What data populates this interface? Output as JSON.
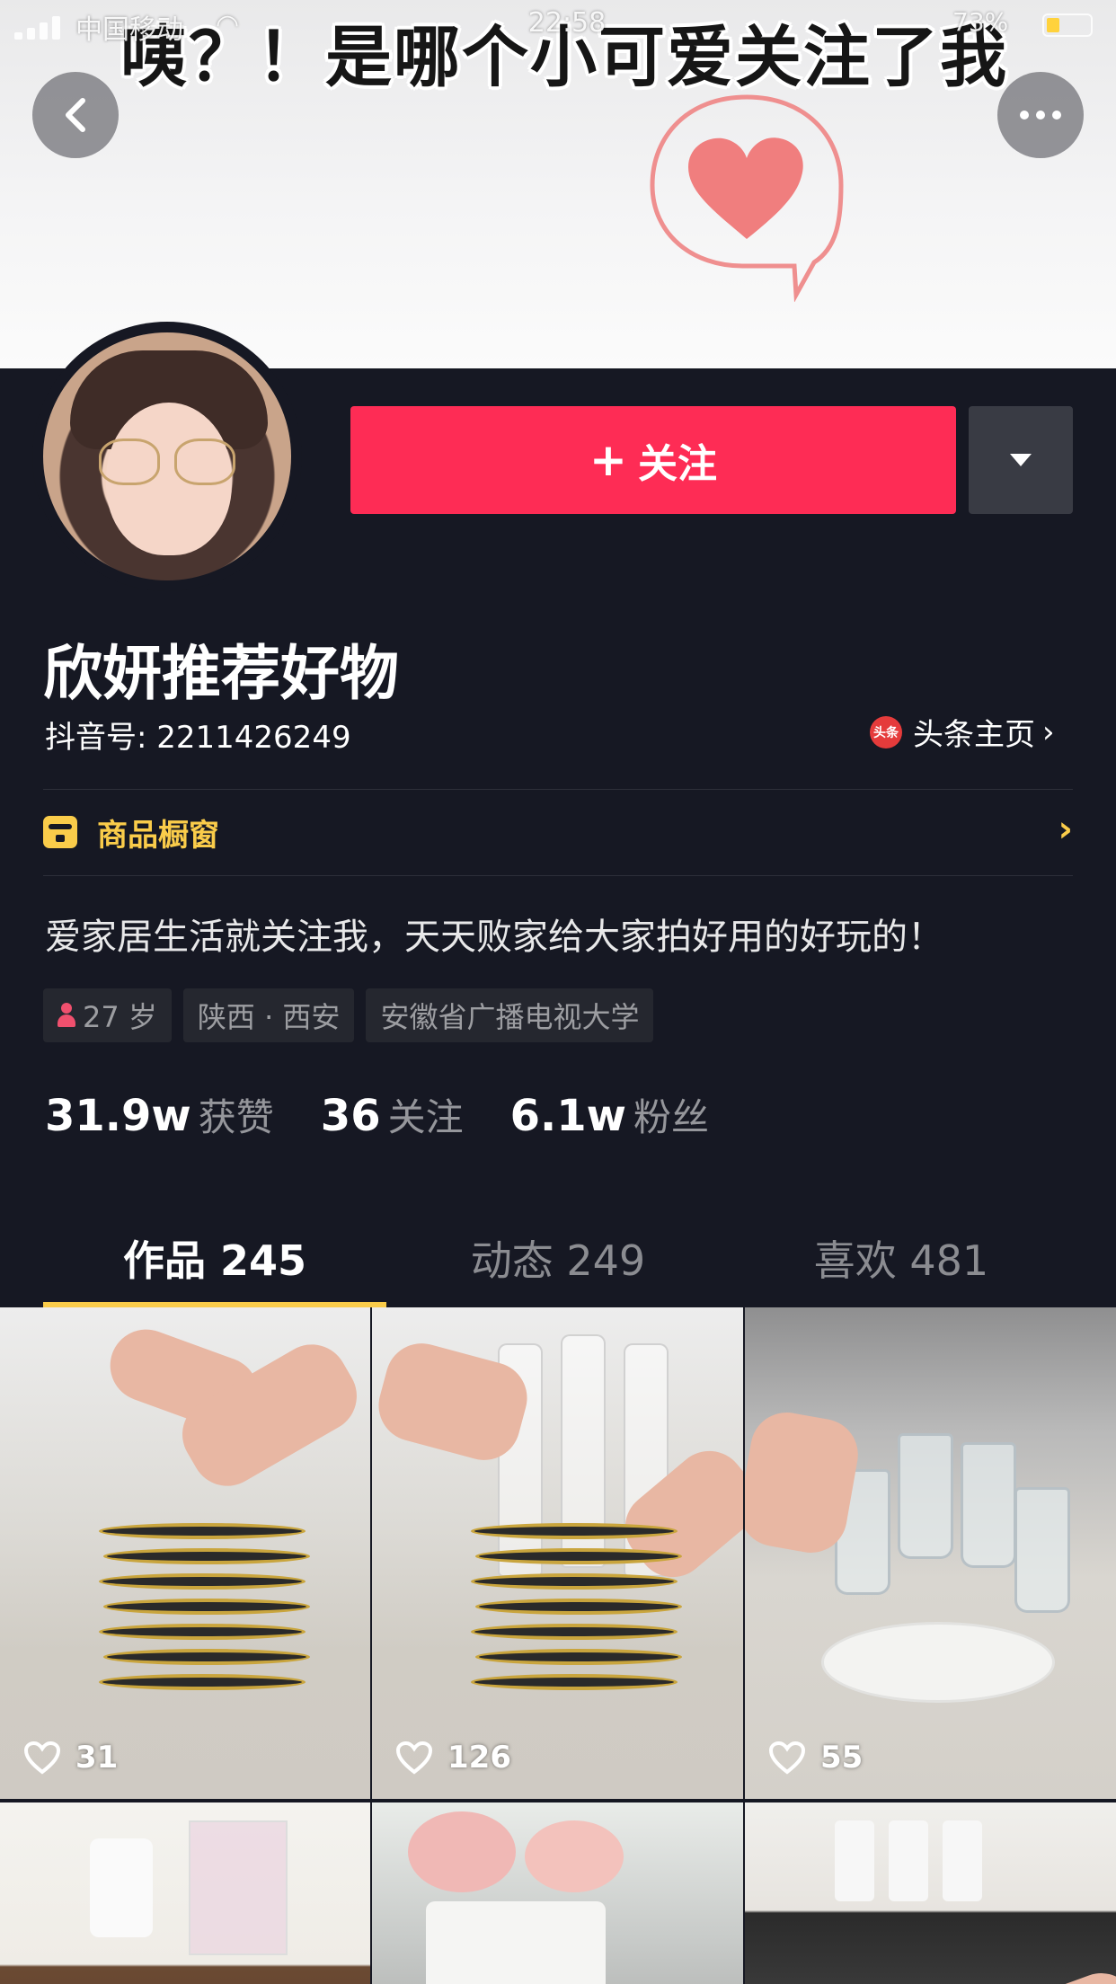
{
  "status_bar": {
    "carrier": "中国移动",
    "time": "22:58",
    "battery_pct": "73%"
  },
  "cover": {
    "caption": "咦？！是哪个小可爱关注了我"
  },
  "profile": {
    "follow_label": "关注",
    "nickname": "欣妍推荐好物",
    "douyin_id": "抖音号: 2211426249",
    "toutiao_badge": "头条",
    "toutiao_label": "头条主页",
    "shop_label": "商品橱窗",
    "bio": "爱家居生活就关注我，天天败家给大家拍好用的好玩的！",
    "tags": {
      "age": "27 岁",
      "location": "陕西 · 西安",
      "school": "安徽省广播电视大学"
    },
    "stats": [
      {
        "num": "31.9w",
        "label": "获赞"
      },
      {
        "num": "36",
        "label": "关注"
      },
      {
        "num": "6.1w",
        "label": "粉丝"
      }
    ]
  },
  "tabs": [
    {
      "label": "作品 245"
    },
    {
      "label": "动态 249"
    },
    {
      "label": "喜欢 481"
    }
  ],
  "videos": [
    {
      "likes": "31"
    },
    {
      "likes": "126"
    },
    {
      "likes": "55"
    }
  ],
  "colors": {
    "background": "#161823",
    "follow_button": "#fe2c55",
    "accent_yellow": "#facc4a"
  },
  "icons": [
    "back-icon",
    "more-icon",
    "caret-down-icon",
    "toutiao-icon",
    "shop-icon",
    "gender-female-icon",
    "heart-icon"
  ]
}
